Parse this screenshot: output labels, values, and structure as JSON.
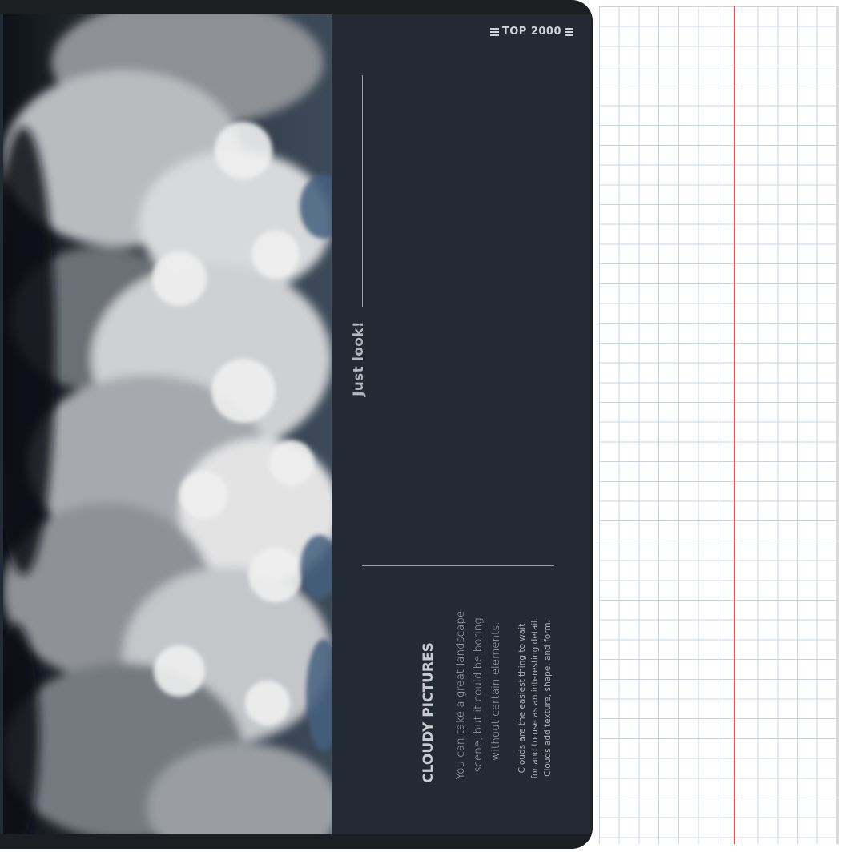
{
  "brand": {
    "logo_text": "TOP 2000"
  },
  "cover": {
    "tagline": "Just look!",
    "title": "CLOUDY PICTURES",
    "paragraph_lines": [
      "You can take a great landscape",
      "scene, but it could be boring",
      "without certain elements."
    ],
    "note_lines": [
      "Clouds are the easiest thing to wait",
      "for and to use as an interesting detail.",
      "Clouds add texture, shape, and form."
    ]
  },
  "colors": {
    "cover_bg": "#232a33",
    "margin_line": "#ef5350",
    "grid_line": "#c7d2ea"
  },
  "icons": {
    "logo_bars": "logo-bars-icon"
  }
}
